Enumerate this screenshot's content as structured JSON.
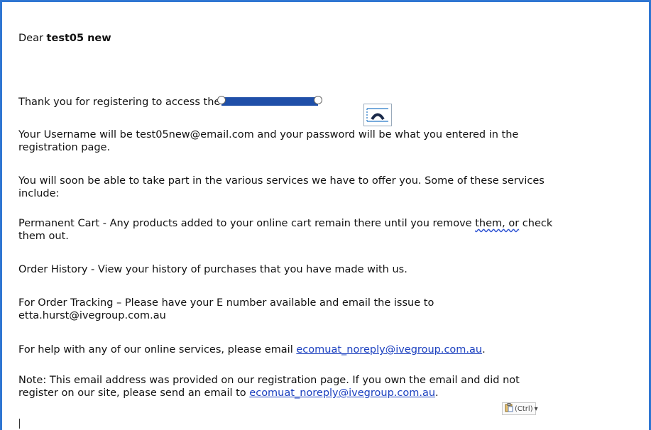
{
  "email": {
    "greeting_prefix": "Dear ",
    "greeting_name": "test05 new",
    "thanks_text": "Thank you for registering to access the",
    "username_line1": "Your Username will be test05new@email.com and your password will be what you entered in the",
    "username_line2": "registration page.",
    "services_line1": "You will soon be able to take part in the various services we have to offer you. Some of these services",
    "services_line2": "include:",
    "cart_line1a": "Permanent Cart - Any products added to your online cart remain there until you remove ",
    "cart_line1b": "them, or",
    "cart_line1c": " check",
    "cart_line2": "them out.",
    "history_line": "Order History - View your history of purchases that you have made with us.",
    "tracking_line1": "For Order Tracking – Please have your E number available and email the issue to",
    "tracking_line2": "etta.hurst@ivegroup.com.au",
    "help_text": "For help with any of our online services, please email ",
    "help_link": "ecomuat_noreply@ivegroup.com.au",
    "help_end": ".",
    "note_line1": "Note: This email address was provided on our registration page. If you own the email and did not",
    "note_line2_text": "register on our site, please send an email to ",
    "note_link": "ecomuat_noreply@ivegroup.com.au",
    "note_end": "."
  },
  "paste_options": {
    "label": "(Ctrl)",
    "icon": "clipboard-icon"
  },
  "colors": {
    "frame_border": "#2f76d2",
    "link": "#1a3fbf",
    "selection": "#1f4fa8"
  }
}
